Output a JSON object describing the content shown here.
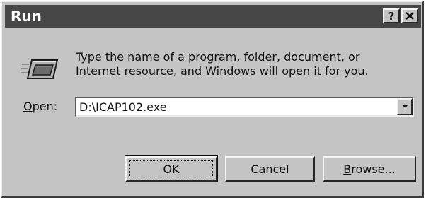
{
  "window": {
    "title": "Run"
  },
  "titlebar": {
    "help_label": "?",
    "close_icon": "close-icon"
  },
  "icon": "run-dialog-icon",
  "description": {
    "line1": "Type the name of a program, folder, document, or",
    "line2": "Internet resource, and Windows will open it for you."
  },
  "open": {
    "label_accel": "O",
    "label_rest": "pen:",
    "value": "D:\\ICAP102.exe",
    "dropdown_icon": "chevron-down-icon"
  },
  "buttons": {
    "ok": "OK",
    "cancel": "Cancel",
    "browse_accel": "B",
    "browse_rest": "rowse..."
  },
  "colors": {
    "titlebar": "#474747",
    "dialog": "#c4c4c4"
  }
}
